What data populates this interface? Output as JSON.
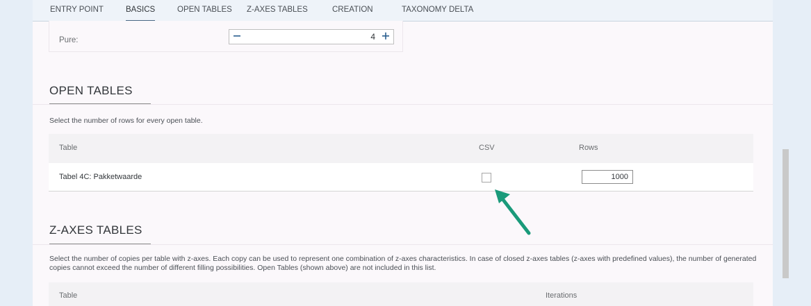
{
  "nav": {
    "tabs": [
      {
        "label": "ENTRY POINT"
      },
      {
        "label": "BASICS"
      },
      {
        "label": "OPEN TABLES"
      },
      {
        "label": "Z-AXES TABLES"
      },
      {
        "label": "CREATION"
      },
      {
        "label": "TAXONOMY DELTA"
      }
    ],
    "active": "BASICS"
  },
  "pure": {
    "label": "Pure:",
    "value": "4"
  },
  "open_tables": {
    "title": "OPEN TABLES",
    "description": "Select the number of rows for every open table.",
    "columns": {
      "table": "Table",
      "csv": "CSV",
      "rows": "Rows"
    },
    "rows": [
      {
        "table": "Tabel 4C: Pakketwaarde",
        "csv_checked": false,
        "rows": "1000"
      }
    ]
  },
  "z_axes_tables": {
    "title": "Z-AXES TABLES",
    "description": "Select the number of copies per table with z-axes. Each copy can be used to represent one combination of z-axes characteristics. In case of closed z-axes tables (z-axes with predefined values), the number of generated copies cannot exceed the number of different filling possibilities. Open Tables (shown above) are not included in this list.",
    "columns": {
      "table": "Table",
      "iterations": "Iterations"
    }
  },
  "colors": {
    "arrow": "#1a9a7a",
    "accent": "#2a5e8f"
  }
}
